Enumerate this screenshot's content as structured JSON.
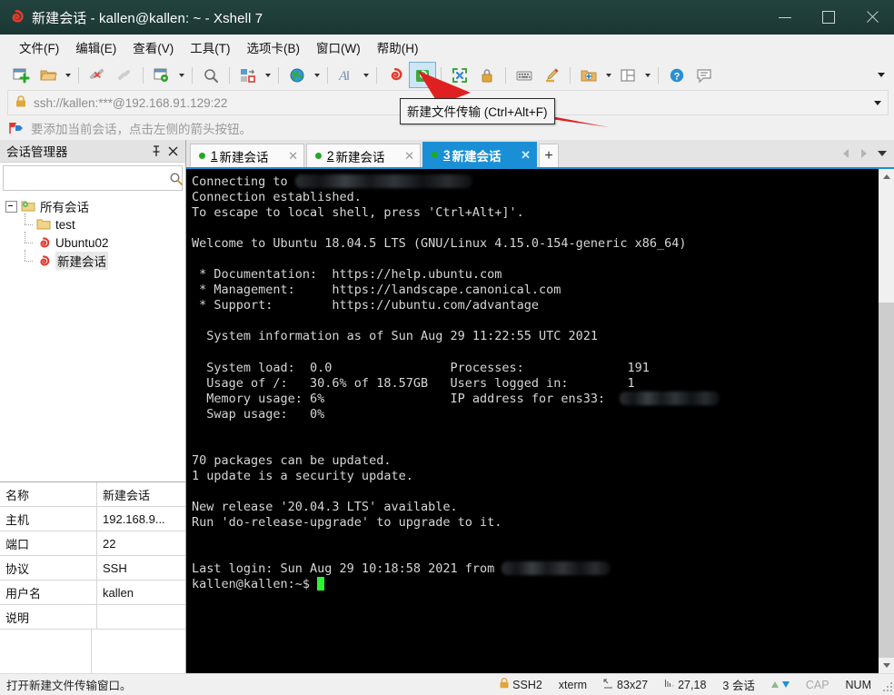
{
  "window": {
    "title": "新建会话 - kallen@kallen: ~ - Xshell 7",
    "app_icon": "xshell-spiral-icon",
    "minimize": "minimize-button",
    "maximize": "maximize-button",
    "close": "close-button"
  },
  "menubar": {
    "items": [
      {
        "label": "文件(F)",
        "name": "menu-file"
      },
      {
        "label": "编辑(E)",
        "name": "menu-edit"
      },
      {
        "label": "查看(V)",
        "name": "menu-view"
      },
      {
        "label": "工具(T)",
        "name": "menu-tools"
      },
      {
        "label": "选项卡(B)",
        "name": "menu-tab"
      },
      {
        "label": "窗口(W)",
        "name": "menu-window"
      },
      {
        "label": "帮助(H)",
        "name": "menu-help"
      }
    ]
  },
  "toolbar": {
    "overflow_label": "toolbar-overflow"
  },
  "tooltip": {
    "text": "新建文件传输 (Ctrl+Alt+F)"
  },
  "addressbar": {
    "url": "ssh://kallen:***@192.168.91.129:22",
    "lock_icon": "lock-icon"
  },
  "hintbar": {
    "text": "要添加当前会话，点击左侧的箭头按钮。"
  },
  "session_manager": {
    "title": "会话管理器",
    "search_placeholder": "",
    "search_value": "",
    "tree": [
      {
        "label": "所有会话",
        "icon": "folder-gear-icon",
        "level": 0
      },
      {
        "label": "test",
        "icon": "folder-icon",
        "level": 1
      },
      {
        "label": "Ubuntu02",
        "icon": "session-spiral-icon",
        "level": 1
      },
      {
        "label": "新建会话",
        "icon": "session-spiral-icon",
        "level": 1,
        "selected": true
      }
    ]
  },
  "properties": {
    "rows": [
      {
        "key": "名称",
        "value": "新建会话"
      },
      {
        "key": "主机",
        "value": "192.168.9..."
      },
      {
        "key": "端口",
        "value": "22"
      },
      {
        "key": "协议",
        "value": "SSH"
      },
      {
        "key": "用户名",
        "value": "kallen"
      },
      {
        "key": "说明",
        "value": ""
      }
    ]
  },
  "tabs": {
    "items": [
      {
        "num": "1",
        "label": "新建会话",
        "active": false
      },
      {
        "num": "2",
        "label": "新建会话",
        "active": false
      },
      {
        "num": "3",
        "label": "新建会话",
        "active": true
      }
    ],
    "add_label": "+",
    "active_color": "#1a8fd6"
  },
  "terminal": {
    "lines": [
      {
        "text": "Connecting to ",
        "blur": 195
      },
      {
        "text": "Connection established."
      },
      {
        "text": "To escape to local shell, press 'Ctrl+Alt+]'."
      },
      {
        "text": ""
      },
      {
        "text": "Welcome to Ubuntu 18.04.5 LTS (GNU/Linux 4.15.0-154-generic x86_64)"
      },
      {
        "text": ""
      },
      {
        "text": " * Documentation:  https://help.ubuntu.com"
      },
      {
        "text": " * Management:     https://landscape.canonical.com"
      },
      {
        "text": " * Support:        https://ubuntu.com/advantage"
      },
      {
        "text": ""
      },
      {
        "text": "  System information as of Sun Aug 29 11:22:55 UTC 2021"
      },
      {
        "text": ""
      },
      {
        "text": "  System load:  0.0                Processes:              191"
      },
      {
        "text": "  Usage of /:   30.6% of 18.57GB   Users logged in:        1"
      },
      {
        "text": "  Memory usage: 6%                 IP address for ens33:  ",
        "blur": 110
      },
      {
        "text": "  Swap usage:   0%"
      },
      {
        "text": ""
      },
      {
        "text": ""
      },
      {
        "text": "70 packages can be updated."
      },
      {
        "text": "1 update is a security update."
      },
      {
        "text": ""
      },
      {
        "text": "New release '20.04.3 LTS' available."
      },
      {
        "text": "Run 'do-release-upgrade' to upgrade to it."
      },
      {
        "text": ""
      },
      {
        "text": ""
      },
      {
        "text": "Last login: Sun Aug 29 10:18:58 2021 from ",
        "blur": 120
      },
      {
        "text": "kallen@kallen:~$ ",
        "cursor": true
      }
    ],
    "background": "#000000",
    "foreground": "#d6d6d6",
    "cursor_color": "#2df52d"
  },
  "statusbar": {
    "message": "打开新建文件传输窗口。",
    "protocol": "SSH2",
    "term_type": "xterm",
    "size": "83x27",
    "cursor_pos": "27,18",
    "sessions": "3 会话",
    "cap": "CAP",
    "num": "NUM"
  }
}
